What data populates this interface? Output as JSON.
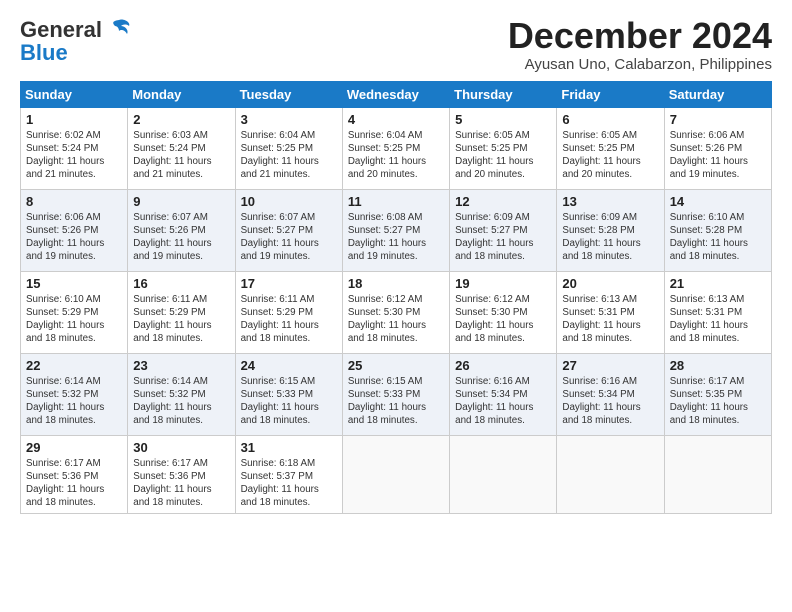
{
  "logo": {
    "line1": "General",
    "line2": "Blue"
  },
  "title": "December 2024",
  "location": "Ayusan Uno, Calabarzon, Philippines",
  "weekdays": [
    "Sunday",
    "Monday",
    "Tuesday",
    "Wednesday",
    "Thursday",
    "Friday",
    "Saturday"
  ],
  "weeks": [
    [
      {
        "day": 1,
        "info": "Sunrise: 6:02 AM\nSunset: 5:24 PM\nDaylight: 11 hours\nand 21 minutes."
      },
      {
        "day": 2,
        "info": "Sunrise: 6:03 AM\nSunset: 5:24 PM\nDaylight: 11 hours\nand 21 minutes."
      },
      {
        "day": 3,
        "info": "Sunrise: 6:04 AM\nSunset: 5:25 PM\nDaylight: 11 hours\nand 21 minutes."
      },
      {
        "day": 4,
        "info": "Sunrise: 6:04 AM\nSunset: 5:25 PM\nDaylight: 11 hours\nand 20 minutes."
      },
      {
        "day": 5,
        "info": "Sunrise: 6:05 AM\nSunset: 5:25 PM\nDaylight: 11 hours\nand 20 minutes."
      },
      {
        "day": 6,
        "info": "Sunrise: 6:05 AM\nSunset: 5:25 PM\nDaylight: 11 hours\nand 20 minutes."
      },
      {
        "day": 7,
        "info": "Sunrise: 6:06 AM\nSunset: 5:26 PM\nDaylight: 11 hours\nand 19 minutes."
      }
    ],
    [
      {
        "day": 8,
        "info": "Sunrise: 6:06 AM\nSunset: 5:26 PM\nDaylight: 11 hours\nand 19 minutes."
      },
      {
        "day": 9,
        "info": "Sunrise: 6:07 AM\nSunset: 5:26 PM\nDaylight: 11 hours\nand 19 minutes."
      },
      {
        "day": 10,
        "info": "Sunrise: 6:07 AM\nSunset: 5:27 PM\nDaylight: 11 hours\nand 19 minutes."
      },
      {
        "day": 11,
        "info": "Sunrise: 6:08 AM\nSunset: 5:27 PM\nDaylight: 11 hours\nand 19 minutes."
      },
      {
        "day": 12,
        "info": "Sunrise: 6:09 AM\nSunset: 5:27 PM\nDaylight: 11 hours\nand 18 minutes."
      },
      {
        "day": 13,
        "info": "Sunrise: 6:09 AM\nSunset: 5:28 PM\nDaylight: 11 hours\nand 18 minutes."
      },
      {
        "day": 14,
        "info": "Sunrise: 6:10 AM\nSunset: 5:28 PM\nDaylight: 11 hours\nand 18 minutes."
      }
    ],
    [
      {
        "day": 15,
        "info": "Sunrise: 6:10 AM\nSunset: 5:29 PM\nDaylight: 11 hours\nand 18 minutes."
      },
      {
        "day": 16,
        "info": "Sunrise: 6:11 AM\nSunset: 5:29 PM\nDaylight: 11 hours\nand 18 minutes."
      },
      {
        "day": 17,
        "info": "Sunrise: 6:11 AM\nSunset: 5:29 PM\nDaylight: 11 hours\nand 18 minutes."
      },
      {
        "day": 18,
        "info": "Sunrise: 6:12 AM\nSunset: 5:30 PM\nDaylight: 11 hours\nand 18 minutes."
      },
      {
        "day": 19,
        "info": "Sunrise: 6:12 AM\nSunset: 5:30 PM\nDaylight: 11 hours\nand 18 minutes."
      },
      {
        "day": 20,
        "info": "Sunrise: 6:13 AM\nSunset: 5:31 PM\nDaylight: 11 hours\nand 18 minutes."
      },
      {
        "day": 21,
        "info": "Sunrise: 6:13 AM\nSunset: 5:31 PM\nDaylight: 11 hours\nand 18 minutes."
      }
    ],
    [
      {
        "day": 22,
        "info": "Sunrise: 6:14 AM\nSunset: 5:32 PM\nDaylight: 11 hours\nand 18 minutes."
      },
      {
        "day": 23,
        "info": "Sunrise: 6:14 AM\nSunset: 5:32 PM\nDaylight: 11 hours\nand 18 minutes."
      },
      {
        "day": 24,
        "info": "Sunrise: 6:15 AM\nSunset: 5:33 PM\nDaylight: 11 hours\nand 18 minutes."
      },
      {
        "day": 25,
        "info": "Sunrise: 6:15 AM\nSunset: 5:33 PM\nDaylight: 11 hours\nand 18 minutes."
      },
      {
        "day": 26,
        "info": "Sunrise: 6:16 AM\nSunset: 5:34 PM\nDaylight: 11 hours\nand 18 minutes."
      },
      {
        "day": 27,
        "info": "Sunrise: 6:16 AM\nSunset: 5:34 PM\nDaylight: 11 hours\nand 18 minutes."
      },
      {
        "day": 28,
        "info": "Sunrise: 6:17 AM\nSunset: 5:35 PM\nDaylight: 11 hours\nand 18 minutes."
      }
    ],
    [
      {
        "day": 29,
        "info": "Sunrise: 6:17 AM\nSunset: 5:36 PM\nDaylight: 11 hours\nand 18 minutes."
      },
      {
        "day": 30,
        "info": "Sunrise: 6:17 AM\nSunset: 5:36 PM\nDaylight: 11 hours\nand 18 minutes."
      },
      {
        "day": 31,
        "info": "Sunrise: 6:18 AM\nSunset: 5:37 PM\nDaylight: 11 hours\nand 18 minutes."
      },
      null,
      null,
      null,
      null
    ]
  ]
}
